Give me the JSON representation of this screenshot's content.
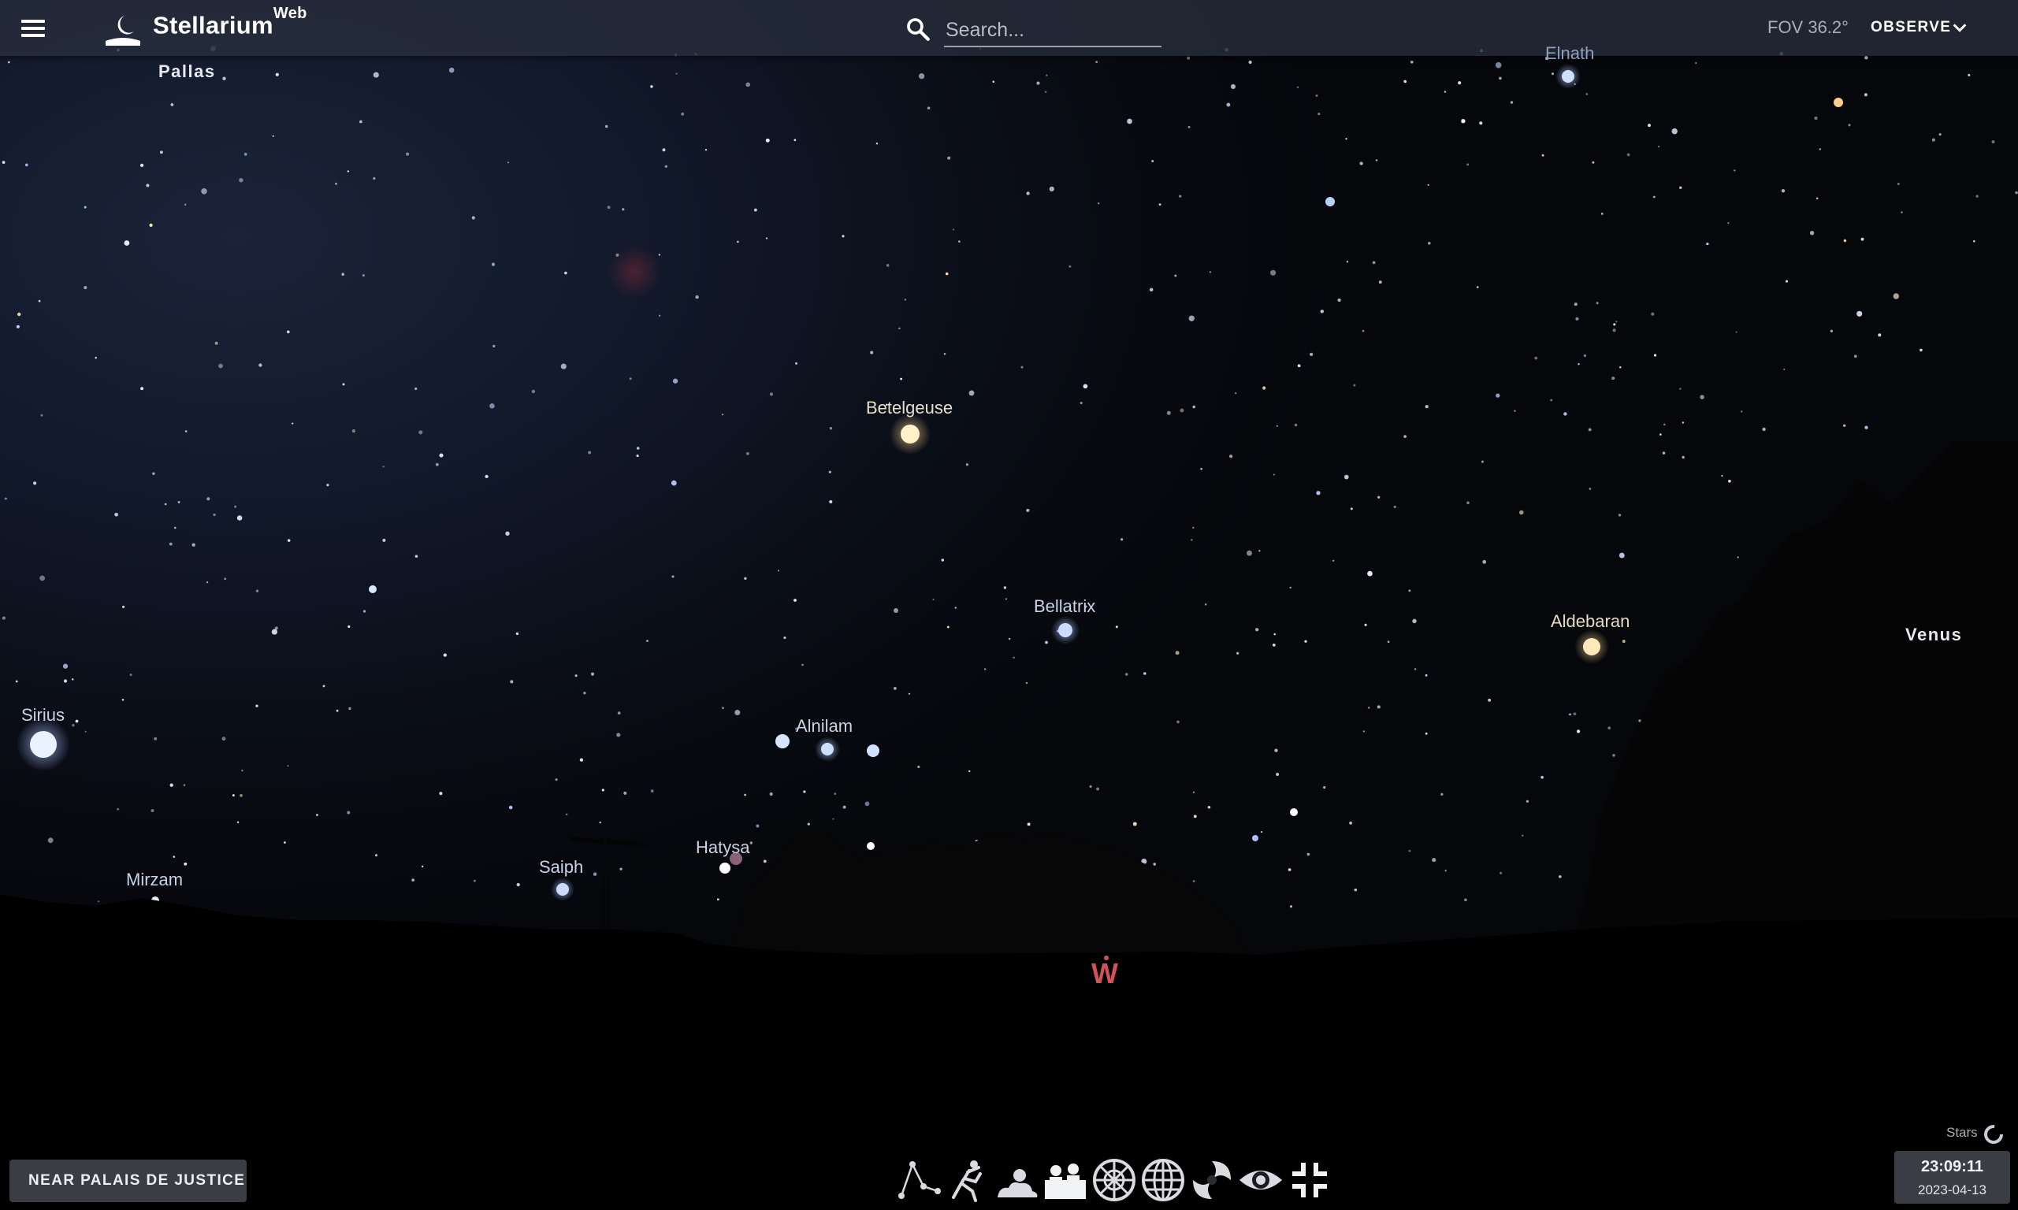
{
  "app": {
    "brand": "Stellarium",
    "brand_sup": "Web"
  },
  "topbar": {
    "menu_icon": "menu-icon",
    "logo_icon": "stellarium-moon-logo",
    "search_icon": "search-icon",
    "search_placeholder": "Search...",
    "fov": "FOV 36.2°",
    "observe_label": "OBSERVE",
    "observe_icon": "chevron-down-icon"
  },
  "sky": {
    "star_labels": [
      "Elnath",
      "Betelgeuse",
      "Bellatrix",
      "Aldebaran",
      "Sirius",
      "Alnilam",
      "Hatysa",
      "Saiph",
      "Mirzam"
    ],
    "planet_labels": [
      "Pallas",
      "Venus"
    ],
    "compass": "W"
  },
  "bottom": {
    "location": "NEAR PALAIS DE JUSTICE",
    "toolbar_icons": [
      "constellation-lines-icon",
      "constellation-art-icon",
      "atmosphere-icon",
      "landscape-icon",
      "azimuthal-grid-icon",
      "equatorial-grid-icon",
      "deep-sky-objects-icon",
      "night-mode-icon",
      "exit-fullscreen-icon"
    ],
    "stars_status": "Stars",
    "time": "23:09:11",
    "date": "2023-04-13"
  },
  "colors": {
    "topbar_bg": "#282e3c",
    "compass": "#d2525b",
    "button_bg": "#3a3d44"
  }
}
